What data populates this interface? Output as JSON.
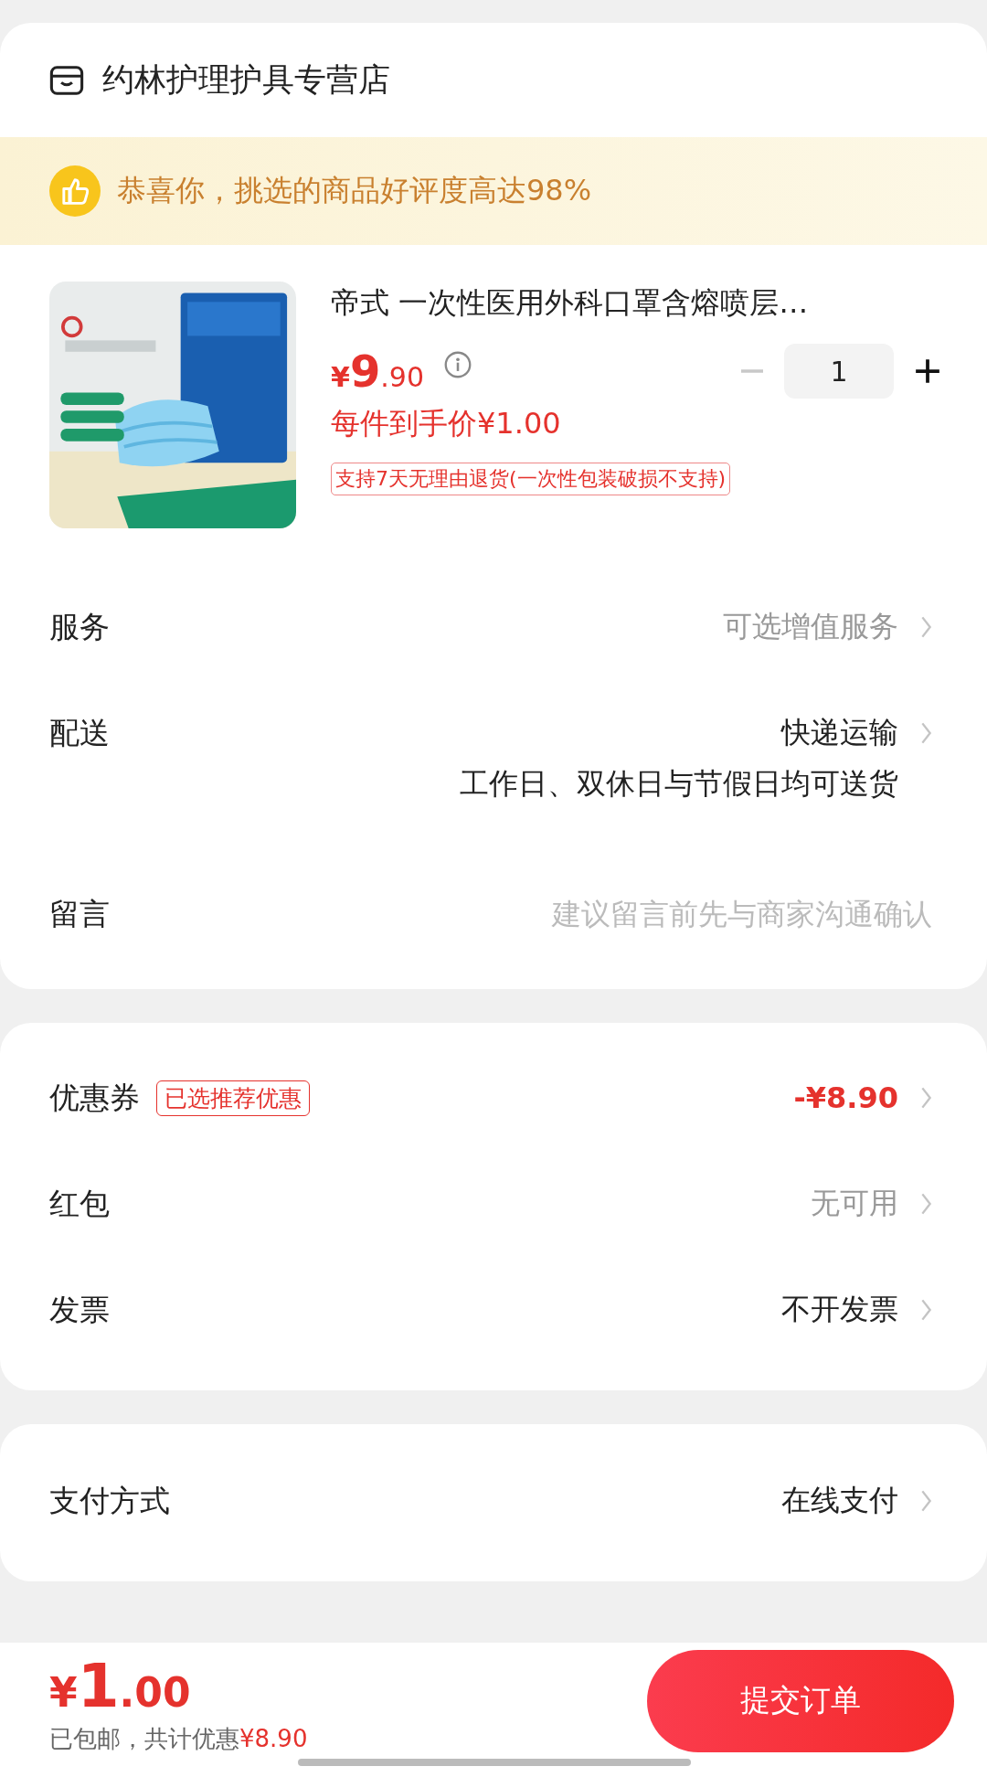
{
  "store": {
    "name": "约林护理护具专营店"
  },
  "banner": {
    "text": "恭喜你，挑选的商品好评度高达98%"
  },
  "product": {
    "title": "帝式 一次性医用外科口罩含熔喷层…",
    "price": {
      "symbol": "¥",
      "integer": "9",
      "decimal": ".90"
    },
    "quantity": "1",
    "minus_disabled": true,
    "unit_price": "每件到手价¥1.00",
    "return_tag": "支持7天无理由退货(一次性包装破损不支持)"
  },
  "order_rows": [
    {
      "kind": "link",
      "label": "服务",
      "value": "可选增值服务",
      "muted": true
    },
    {
      "kind": "link",
      "label": "配送",
      "value": "快递运输",
      "muted": false,
      "note": "工作日、双休日与节假日均可送货"
    },
    {
      "kind": "input",
      "label": "留言",
      "placeholder": "建议留言前先与商家沟通确认"
    }
  ],
  "discount_rows": [
    {
      "kind": "link",
      "label": "优惠券",
      "tag": "已选推荐优惠",
      "value": "-¥8.90",
      "highlight": true,
      "muted": false
    },
    {
      "kind": "link",
      "label": "红包",
      "value": "无可用",
      "highlight": false,
      "muted": true
    },
    {
      "kind": "link",
      "label": "发票",
      "value": "不开发票",
      "highlight": false,
      "muted": false
    }
  ],
  "payment_rows": [
    {
      "kind": "link",
      "label": "支付方式",
      "value": "在线支付",
      "muted": false
    }
  ],
  "footer": {
    "total": {
      "symbol": "¥",
      "integer": "1",
      "decimal": ".00"
    },
    "summary": "已包邮，共计优惠",
    "summary_amount": "¥8.90",
    "submit": "提交订单"
  }
}
